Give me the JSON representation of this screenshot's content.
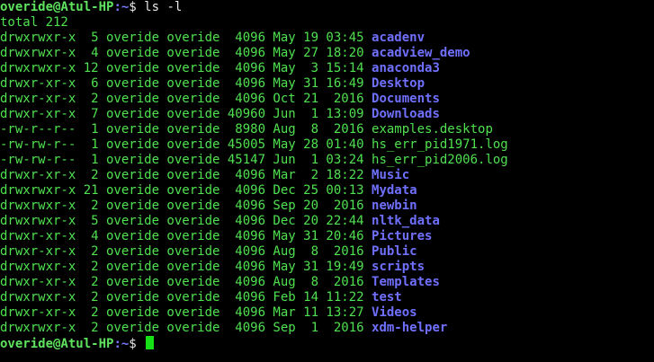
{
  "colors": {
    "background": "#000000",
    "text": "#4fe14f",
    "directory": "#7070ff",
    "cursor": "#16e016"
  },
  "prompt_top": {
    "user_host": "overide@Atul-HP",
    "path": ":~",
    "symbol": "$ ",
    "command": "ls -l"
  },
  "total": "total 212",
  "entries": [
    {
      "meta": "drwxrwxr-x  5 overide overide  4096 May 19 03:45 ",
      "name": "acadenv",
      "type": "dir"
    },
    {
      "meta": "drwxrwxr-x  4 overide overide  4096 May 27 18:20 ",
      "name": "acadview_demo",
      "type": "dir"
    },
    {
      "meta": "drwxrwxr-x 12 overide overide  4096 May  3 15:14 ",
      "name": "anaconda3",
      "type": "dir"
    },
    {
      "meta": "drwxr-xr-x  6 overide overide  4096 May 31 16:49 ",
      "name": "Desktop",
      "type": "dir"
    },
    {
      "meta": "drwxr-xr-x  2 overide overide  4096 Oct 21  2016 ",
      "name": "Documents",
      "type": "dir"
    },
    {
      "meta": "drwxr-xr-x  7 overide overide 40960 Jun  1 13:09 ",
      "name": "Downloads",
      "type": "dir"
    },
    {
      "meta": "-rw-r--r--  1 overide overide  8980 Aug  8  2016 ",
      "name": "examples.desktop",
      "type": "file"
    },
    {
      "meta": "-rw-rw-r--  1 overide overide 45005 May 28 01:40 ",
      "name": "hs_err_pid1971.log",
      "type": "file"
    },
    {
      "meta": "-rw-rw-r--  1 overide overide 45147 Jun  1 03:24 ",
      "name": "hs_err_pid2006.log",
      "type": "file"
    },
    {
      "meta": "drwxr-xr-x  2 overide overide  4096 Mar  2 18:22 ",
      "name": "Music",
      "type": "dir"
    },
    {
      "meta": "drwxrwxr-x 21 overide overide  4096 Dec 25 00:13 ",
      "name": "Mydata",
      "type": "dir"
    },
    {
      "meta": "drwxrwxr-x  2 overide overide  4096 Sep 20  2016 ",
      "name": "newbin",
      "type": "dir"
    },
    {
      "meta": "drwxrwxr-x  5 overide overide  4096 Dec 20 22:44 ",
      "name": "nltk_data",
      "type": "dir"
    },
    {
      "meta": "drwxr-xr-x  4 overide overide  4096 May 31 20:46 ",
      "name": "Pictures",
      "type": "dir"
    },
    {
      "meta": "drwxr-xr-x  2 overide overide  4096 Aug  8  2016 ",
      "name": "Public",
      "type": "dir"
    },
    {
      "meta": "drwxrwxr-x  2 overide overide  4096 May 31 19:49 ",
      "name": "scripts",
      "type": "dir"
    },
    {
      "meta": "drwxr-xr-x  2 overide overide  4096 Aug  8  2016 ",
      "name": "Templates",
      "type": "dir"
    },
    {
      "meta": "drwxrwxr-x  2 overide overide  4096 Feb 14 11:22 ",
      "name": "test",
      "type": "dir"
    },
    {
      "meta": "drwxr-xr-x  2 overide overide  4096 Mar 11 13:27 ",
      "name": "Videos",
      "type": "dir"
    },
    {
      "meta": "drwxrwxr-x  2 overide overide  4096 Sep  1  2016 ",
      "name": "xdm-helper",
      "type": "dir"
    }
  ],
  "prompt_bottom": {
    "user_host": "overide@Atul-HP",
    "path": ":~",
    "symbol": "$ "
  }
}
